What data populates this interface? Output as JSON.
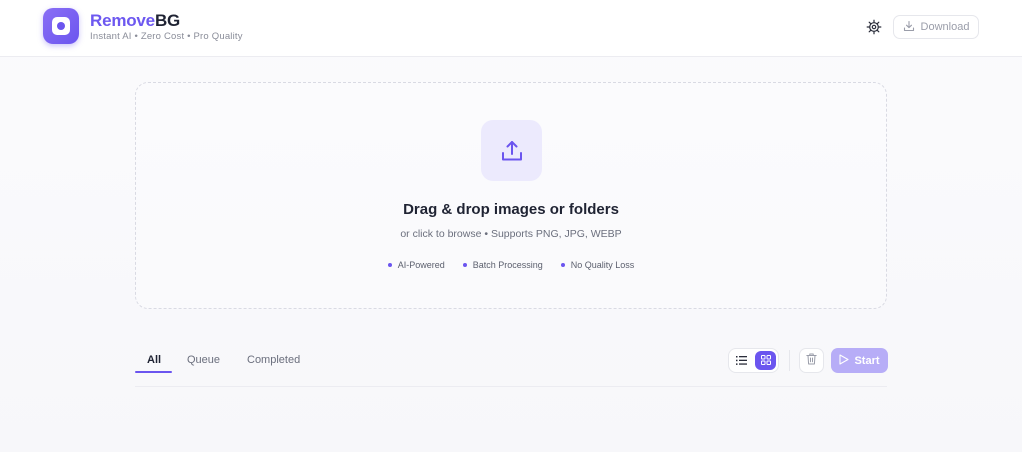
{
  "brand": {
    "name_part1": "Remove",
    "name_part2": "BG",
    "tagline": "Instant AI • Zero Cost • Pro Quality"
  },
  "header": {
    "download_label": "Download",
    "settings_icon": "gear-icon",
    "download_icon": "download-icon"
  },
  "dropzone": {
    "title": "Drag & drop images or folders",
    "subtitle": "or click to browse • Supports PNG, JPG, WEBP",
    "features": [
      "AI-Powered",
      "Batch Processing",
      "No Quality Loss"
    ],
    "icon": "upload-icon"
  },
  "tabs": {
    "items": [
      {
        "label": "All",
        "active": true
      },
      {
        "label": "Queue",
        "active": false
      },
      {
        "label": "Completed",
        "active": false
      }
    ]
  },
  "toolbar": {
    "view_mode": "grid",
    "start_label": "Start",
    "start_enabled": false
  },
  "colors": {
    "accent": "#6b55ef",
    "accent_light": "#eceafd",
    "start_disabled": "#b7adf7",
    "text_primary": "#1f2333",
    "text_muted": "#6b6f7d"
  }
}
